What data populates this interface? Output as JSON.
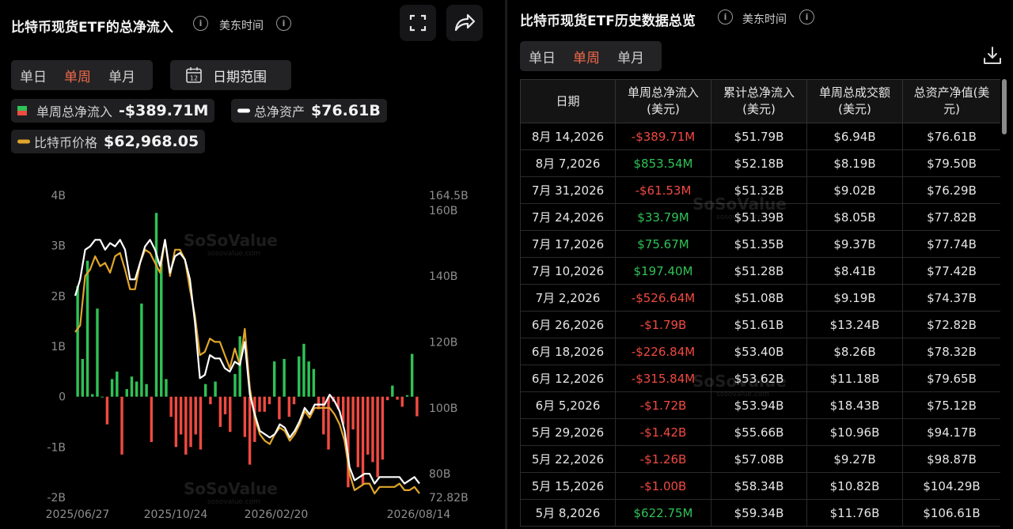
{
  "left": {
    "title": "比特币现货ETF的总净流入",
    "timezone": "美东时间",
    "range_tabs": [
      "单日",
      "单周",
      "单月"
    ],
    "active_tab": 1,
    "date_range_label": "日期范围",
    "calendar_icon_text": "12",
    "legend": [
      {
        "name": "单周总净流入",
        "value": "-$389.71M",
        "color": "#f04a41",
        "color2": "#2fc256",
        "icon": "split-square-icon"
      },
      {
        "name": "总净资产",
        "value": "$76.61B",
        "color": "#ffffff",
        "icon": "line-swatch-icon"
      },
      {
        "name": "比特币价格",
        "value": "$62,968.05",
        "color": "#e0a52a",
        "icon": "line-swatch-icon"
      }
    ],
    "watermark": {
      "brand": "SoSoValue",
      "url": "sosovalue.com"
    }
  },
  "chart_data": {
    "type": "bar",
    "x_ticks": [
      "2025/06/27",
      "2025/10/24",
      "2026/02/20",
      "2026/08/14"
    ],
    "left_axis": {
      "ticks": [
        "4B",
        "3B",
        "2B",
        "1B",
        "0",
        "-1B",
        "-2B"
      ],
      "ylim": [
        -2,
        4
      ],
      "unit": "B USD"
    },
    "right_axis": {
      "ticks": [
        "164.5B",
        "160B",
        "140B",
        "120B",
        "100B",
        "80B",
        "72.82B"
      ],
      "ylim": [
        72.82,
        164.5
      ],
      "unit": "B USD"
    },
    "grid": false,
    "series": [
      {
        "name": "单周总净流入",
        "type": "bar",
        "axis": "left",
        "colors": {
          "positive": "#2fc256",
          "negative": "#f04a41"
        },
        "values": [
          2.2,
          0.75,
          2.7,
          0.05,
          1.75,
          0,
          -0.55,
          0.35,
          0.5,
          -1.15,
          0.15,
          0.4,
          0.3,
          1.85,
          0.25,
          -0.9,
          3.65,
          2.65,
          0.35,
          -0.4,
          -1.0,
          -0.75,
          -1.15,
          -1.0,
          -0.75,
          -1.05,
          0.25,
          -0.15,
          0.3,
          -0.6,
          -0.35,
          -0.7,
          0.45,
          1.2,
          -0.8,
          -1.35,
          -0.9,
          -0.3,
          -0.3,
          -0.15,
          0.7,
          -0.45,
          0.75,
          -0.4,
          -0.15,
          0.8,
          1.05,
          0.7,
          0.55,
          -0.25,
          -0.75,
          -1.05,
          -0.1,
          -0.25,
          -0.55,
          -1.8,
          -0.65,
          -1.4,
          -1.75,
          -1.15,
          -1.3,
          -1.6,
          -1.25,
          -0.07,
          0.22,
          -0.06,
          -0.2,
          0.03,
          0.85,
          -0.39
        ]
      },
      {
        "name": "总净资产",
        "type": "line",
        "axis": "right",
        "color": "#ffffff",
        "values": [
          134,
          139,
          148,
          149,
          151,
          151,
          148,
          150,
          149,
          151,
          148,
          139,
          139,
          144,
          149,
          151,
          148,
          143,
          151,
          141,
          146,
          147,
          145,
          139,
          126,
          109,
          110,
          116,
          115,
          115,
          112,
          111,
          114,
          113,
          120,
          104,
          98,
          93,
          92,
          91,
          92,
          95,
          94,
          91,
          93,
          96,
          100,
          98,
          101,
          101,
          101,
          104,
          102,
          99,
          93,
          82,
          78,
          79,
          80,
          80,
          77,
          79,
          79,
          79,
          79,
          79,
          77,
          78,
          79,
          77
        ]
      },
      {
        "name": "比特币价格",
        "type": "line",
        "axis": "right",
        "color": "#e0a52a",
        "values": [
          123,
          125,
          140,
          142,
          146,
          143,
          144,
          141,
          146,
          147,
          142,
          136,
          136,
          144,
          148,
          147,
          144,
          141,
          151,
          140,
          148,
          148,
          145,
          136,
          128,
          116,
          117,
          121,
          120,
          120,
          116,
          112,
          118,
          113,
          124,
          106,
          97,
          92,
          90,
          89,
          92,
          94,
          93,
          90,
          92,
          95,
          99,
          97,
          100,
          100,
          100,
          100,
          98,
          95,
          90,
          80,
          75,
          76,
          77,
          77,
          74,
          76,
          76,
          76,
          76,
          77,
          75,
          75,
          76,
          74
        ]
      }
    ]
  },
  "right": {
    "title": "比特币现货ETF历史数据总览",
    "timezone": "美东时间",
    "range_tabs": [
      "单日",
      "单周",
      "单月"
    ],
    "active_tab": 1,
    "columns": [
      "日期",
      "单周总净流入\n(美元)",
      "累计总净流入\n(美元)",
      "单周总成交额\n(美元)",
      "总资产净值(美\n元)"
    ],
    "rows": [
      [
        "8月 14,2026",
        "-$389.71M",
        "$51.79B",
        "$6.94B",
        "$76.61B"
      ],
      [
        "8月 7,2026",
        "$853.54M",
        "$52.18B",
        "$8.19B",
        "$79.50B"
      ],
      [
        "7月 31,2026",
        "-$61.53M",
        "$51.32B",
        "$9.02B",
        "$76.29B"
      ],
      [
        "7月 24,2026",
        "$33.79M",
        "$51.39B",
        "$8.05B",
        "$77.82B"
      ],
      [
        "7月 17,2026",
        "$75.67M",
        "$51.35B",
        "$9.37B",
        "$77.74B"
      ],
      [
        "7月 10,2026",
        "$197.40M",
        "$51.28B",
        "$8.41B",
        "$77.42B"
      ],
      [
        "7月 2,2026",
        "-$526.64M",
        "$51.08B",
        "$9.19B",
        "$74.37B"
      ],
      [
        "6月 26,2026",
        "-$1.79B",
        "$51.61B",
        "$13.24B",
        "$72.82B"
      ],
      [
        "6月 18,2026",
        "-$226.84M",
        "$53.40B",
        "$8.26B",
        "$78.32B"
      ],
      [
        "6月 12,2026",
        "-$315.84M",
        "$53.62B",
        "$11.18B",
        "$79.65B"
      ],
      [
        "6月 5,2026",
        "-$1.72B",
        "$53.94B",
        "$18.43B",
        "$75.12B"
      ],
      [
        "5月 29,2026",
        "-$1.42B",
        "$55.66B",
        "$10.96B",
        "$94.17B"
      ],
      [
        "5月 22,2026",
        "-$1.26B",
        "$57.08B",
        "$9.27B",
        "$98.87B"
      ],
      [
        "5月 15,2026",
        "-$1.00B",
        "$58.34B",
        "$10.82B",
        "$104.29B"
      ],
      [
        "5月 8,2026",
        "$622.75M",
        "$59.34B",
        "$11.76B",
        "$106.61B"
      ]
    ],
    "watermark": {
      "brand": "SoSoValue",
      "url": "sosovalue.com"
    }
  }
}
